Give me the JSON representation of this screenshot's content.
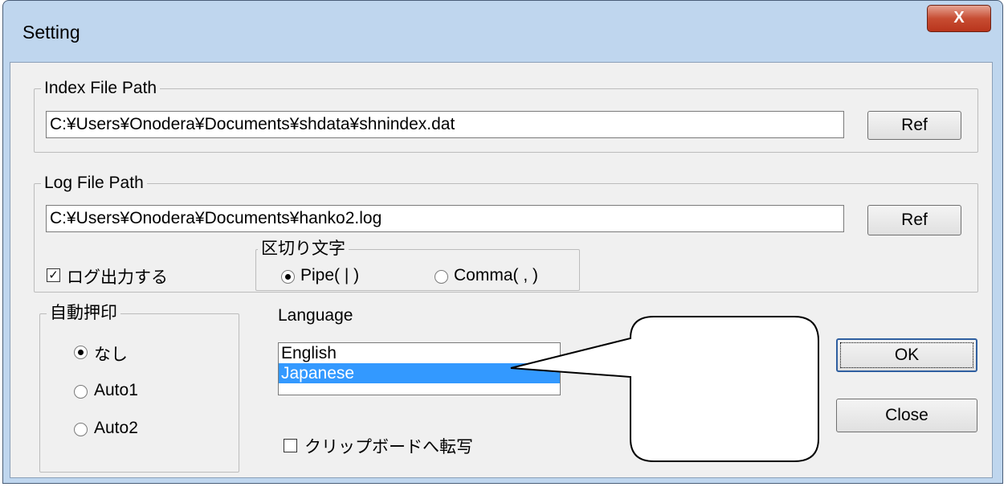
{
  "window": {
    "title": "Setting",
    "close_label": "X"
  },
  "index_group": {
    "legend": "Index File Path",
    "path": "C:¥Users¥Onodera¥Documents¥shdata¥shnindex.dat",
    "ref_label": "Ref"
  },
  "log_group": {
    "legend": "Log File Path",
    "path": "C:¥Users¥Onodera¥Documents¥hanko2.log",
    "ref_label": "Ref",
    "log_output_label": "ログ出力する",
    "log_output_checked": true,
    "delimiter": {
      "legend": "区切り文字",
      "options": [
        "Pipe( | )",
        "Comma( , )"
      ],
      "selected": "Pipe( | )"
    }
  },
  "auto_stamp": {
    "legend": "自動押印",
    "options": [
      "なし",
      "Auto1",
      "Auto2"
    ],
    "selected": "なし"
  },
  "language": {
    "label": "Language",
    "items": [
      "English",
      "Japanese"
    ],
    "selected": "Japanese"
  },
  "clipboard": {
    "label": "クリップボードへ転写",
    "checked": false
  },
  "buttons": {
    "ok": "OK",
    "close": "Close"
  }
}
